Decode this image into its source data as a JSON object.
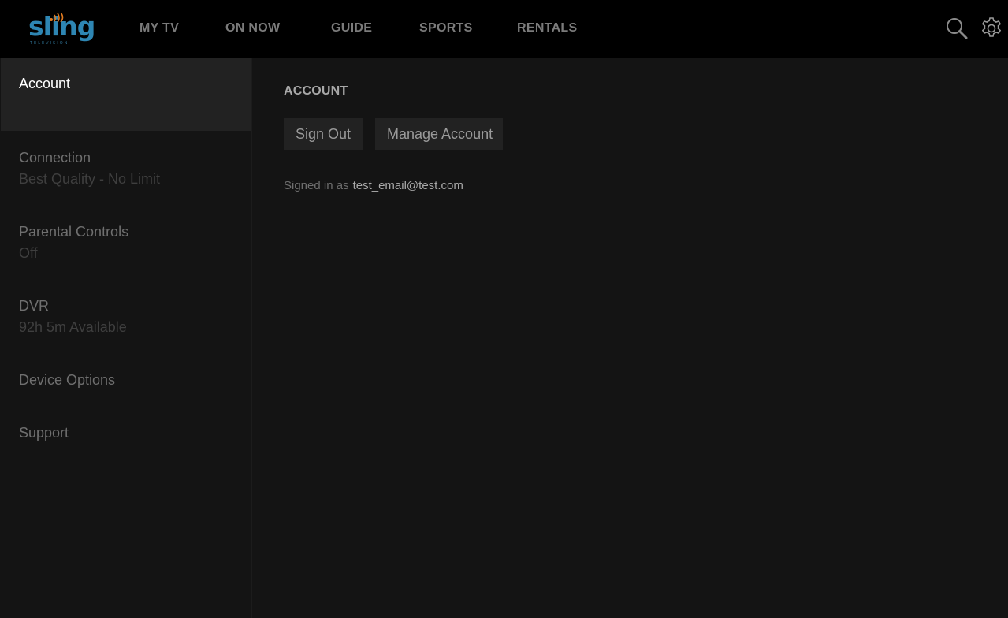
{
  "header": {
    "logo": {
      "wordmark": "sling",
      "tagline": "TELEVISION",
      "brand_color": "#2e86b3",
      "accent_color": "#e07a1f"
    },
    "nav": [
      {
        "label": "MY TV"
      },
      {
        "label": "ON NOW"
      },
      {
        "label": "GUIDE"
      },
      {
        "label": "SPORTS"
      },
      {
        "label": "RENTALS"
      }
    ],
    "icons": [
      "search-icon",
      "gear-icon"
    ]
  },
  "sidebar": {
    "items": [
      {
        "title": "Account",
        "subtitle": "",
        "active": true
      },
      {
        "title": "Connection",
        "subtitle": "Best Quality - No Limit"
      },
      {
        "title": "Parental Controls",
        "subtitle": "Off"
      },
      {
        "title": "DVR",
        "subtitle": "92h 5m Available"
      },
      {
        "title": "Device Options",
        "subtitle": ""
      },
      {
        "title": "Support",
        "subtitle": ""
      }
    ]
  },
  "main": {
    "heading": "ACCOUNT",
    "buttons": {
      "sign_out": "Sign Out",
      "manage_account": "Manage Account"
    },
    "signed_in_label": "Signed in as",
    "email": "test_email@test.com"
  },
  "colors": {
    "background": "#141414",
    "topbar": "#000000",
    "active_item": "#222222",
    "button": "#222222"
  }
}
